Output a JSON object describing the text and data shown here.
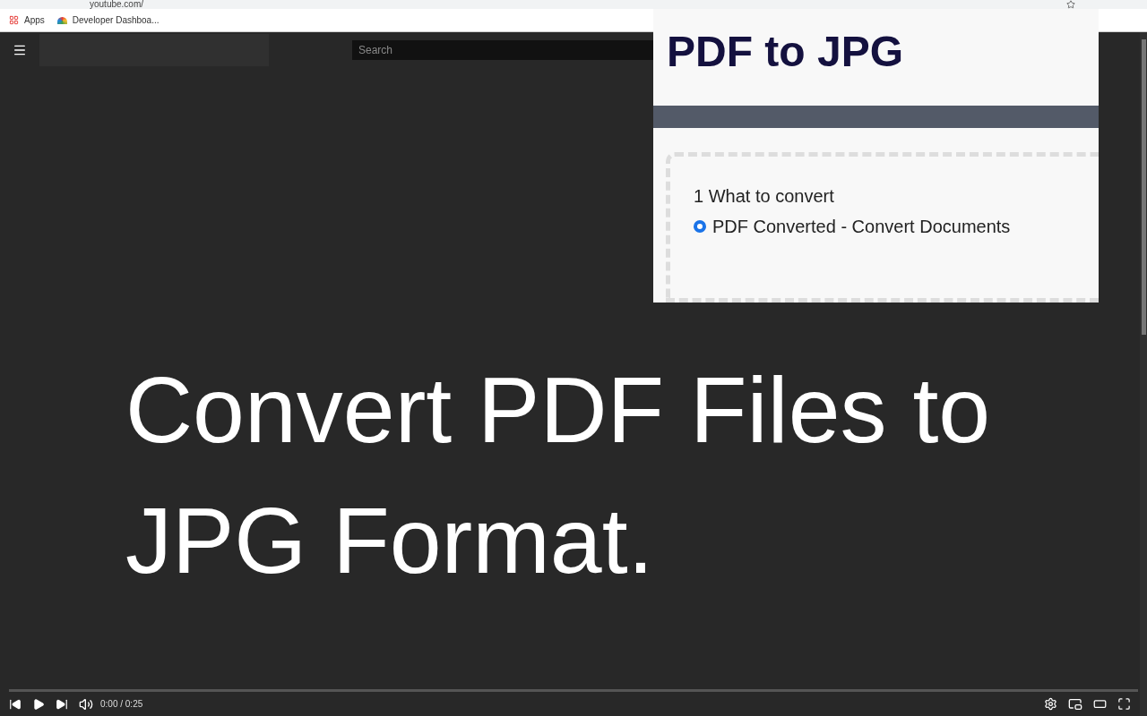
{
  "browser": {
    "address": "youtube.com/",
    "bookmarks": [
      {
        "label": "Apps"
      },
      {
        "label": "Developer Dashboa..."
      }
    ]
  },
  "header": {
    "search": {
      "placeholder": "Search"
    }
  },
  "video": {
    "caption": "Convert PDF Files to JPG Format.",
    "time": "0:00 / 0:25"
  },
  "popup": {
    "title": "PDF to JPG",
    "step": "1 What to convert",
    "options": [
      {
        "label": "PDF Converted - Convert Documents",
        "selected": true
      }
    ]
  }
}
